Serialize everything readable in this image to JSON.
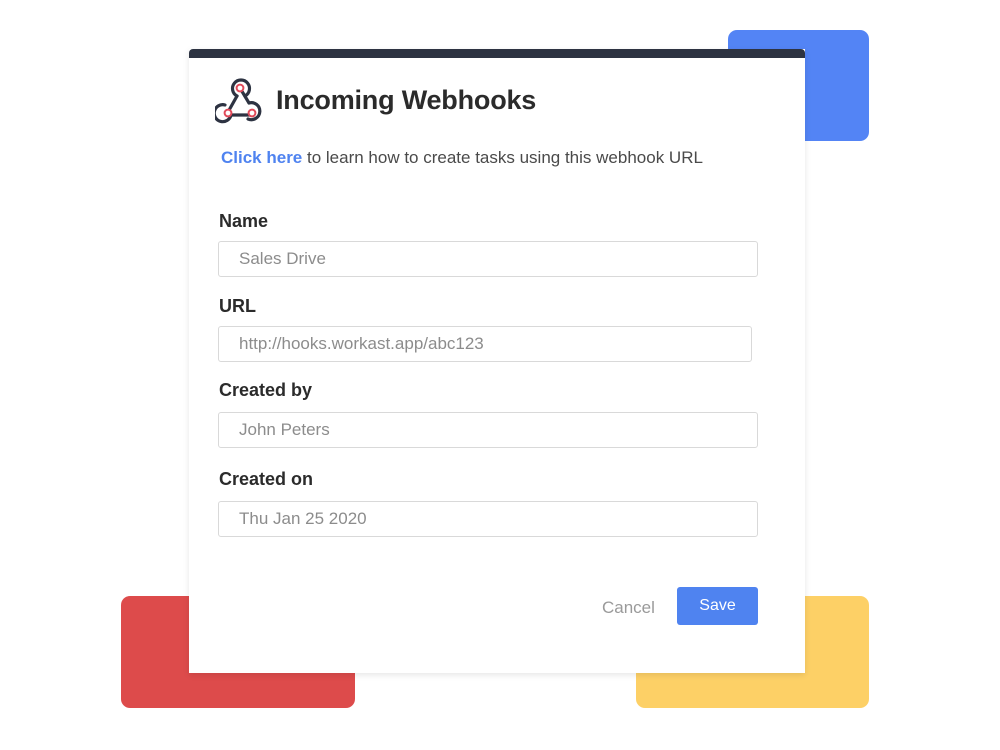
{
  "colors": {
    "accent_blue": "#5384f5",
    "accent_red": "#dd4b4b",
    "accent_yellow": "#fdd066",
    "topbar": "#2d3342",
    "link": "#4f83f0",
    "webhook_red": "#e04a5a"
  },
  "dialog": {
    "title": "Incoming Webhooks",
    "logo_icon": "webhook-icon",
    "help_link": "Click here",
    "help_text": " to learn how to create tasks using this webhook URL"
  },
  "fields": [
    {
      "label": "Name",
      "value": "Sales Drive"
    },
    {
      "label": "URL",
      "value": "http://hooks.workast.app/abc123"
    },
    {
      "label": "Created by",
      "value": "John Peters"
    },
    {
      "label": "Created on",
      "value": "Thu Jan 25 2020"
    }
  ],
  "actions": {
    "cancel_label": "Cancel",
    "save_label": "Save"
  }
}
